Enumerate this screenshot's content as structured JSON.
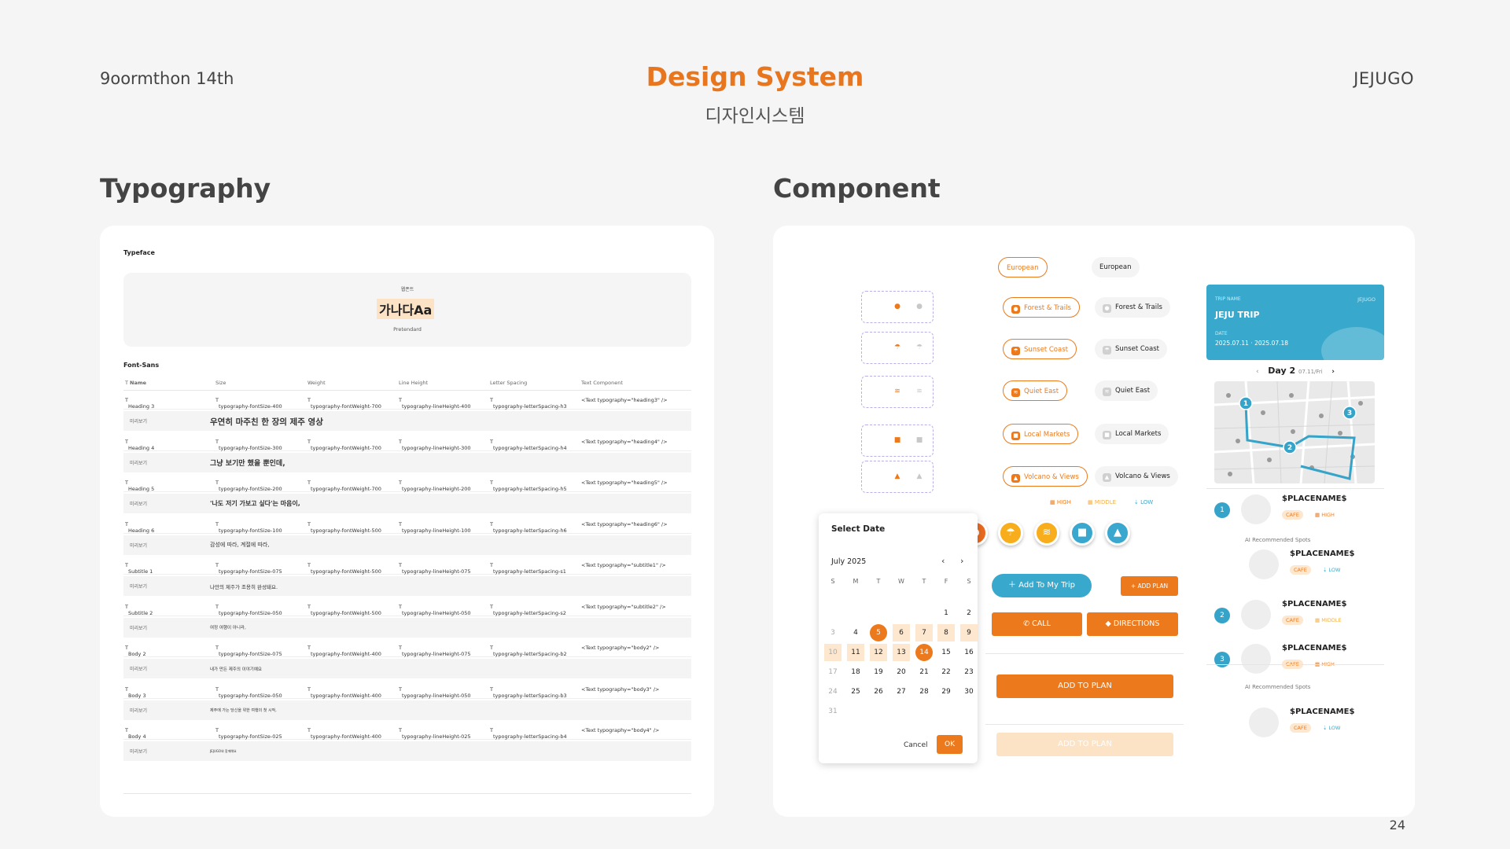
{
  "header": {
    "left": "9oormthon 14th",
    "title": "Design System",
    "subtitle": "디자인시스템",
    "right": "JEJUGO"
  },
  "sections": {
    "typography": "Typography",
    "component": "Component"
  },
  "page_number": "24",
  "typography": {
    "typeface_label": "Typeface",
    "typeface_kr": "웹폰트",
    "typeface_sample": "가나다Aa",
    "typeface_name": "Pretendard",
    "font_sans_label": "Font-Sans",
    "columns": [
      "Name",
      "Size",
      "Weight",
      "Line Height",
      "Letter Spacing",
      "Text Component"
    ],
    "preview_label": "미리보기",
    "rows": [
      {
        "name": "Heading 3",
        "size": "typography-fontSize-400",
        "weight": "typography-fontWeight-700",
        "line": "typography-lineHeight-400",
        "spacing": "typography-letterSpacing-h3",
        "component": "<Text typography=\"heading3\" />",
        "preview": "우연히 마주친 한 장의 제주 영상"
      },
      {
        "name": "Heading 4",
        "size": "typography-fontSize-300",
        "weight": "typography-fontWeight-700",
        "line": "typography-lineHeight-300",
        "spacing": "typography-letterSpacing-h4",
        "component": "<Text typography=\"heading4\" />",
        "preview": "그냥 보기만 했을 뿐인데,"
      },
      {
        "name": "Heading 5",
        "size": "typography-fontSize-200",
        "weight": "typography-fontWeight-700",
        "line": "typography-lineHeight-200",
        "spacing": "typography-letterSpacing-h5",
        "component": "<Text typography=\"heading5\" />",
        "preview": "'나도 저기 가보고 싶다'는 마음이,"
      },
      {
        "name": "Heading 6",
        "size": "typography-fontSize-100",
        "weight": "typography-fontWeight-500",
        "line": "typography-lineHeight-100",
        "spacing": "typography-letterSpacing-h6",
        "component": "<Text typography=\"heading6\" />",
        "preview": "감성에 따라, 계절에 따라,"
      },
      {
        "name": "Subtitle 1",
        "size": "typography-fontSize-075",
        "weight": "typography-fontWeight-500",
        "line": "typography-lineHeight-075",
        "spacing": "typography-letterSpacing-s1",
        "component": "<Text typography=\"subtitle1\" />",
        "preview": "나만의 제주가 조용히 완성돼요."
      },
      {
        "name": "Subtitle 2",
        "size": "typography-fontSize-050",
        "weight": "typography-fontWeight-500",
        "line": "typography-lineHeight-050",
        "spacing": "typography-letterSpacing-s2",
        "component": "<Text typography=\"subtitle2\" />",
        "preview": "여정 여행이 아니라,"
      },
      {
        "name": "Body 2",
        "size": "typography-fontSize-075",
        "weight": "typography-fontWeight-400",
        "line": "typography-lineHeight-075",
        "spacing": "typography-letterSpacing-b2",
        "component": "<Text typography=\"body2\" />",
        "preview": "내가 만든 제주의 이야기예요"
      },
      {
        "name": "Body 3",
        "size": "typography-fontSize-050",
        "weight": "typography-fontWeight-400",
        "line": "typography-lineHeight-050",
        "spacing": "typography-letterSpacing-b3",
        "component": "<Text typography=\"body3\" />",
        "preview": "제주에 가는 당신을 위한 여행의 첫 시작,"
      },
      {
        "name": "Body 4",
        "size": "typography-fontSize-025",
        "weight": "typography-fontWeight-400",
        "line": "typography-lineHeight-025",
        "spacing": "typography-letterSpacing-b4",
        "component": "<Text typography=\"body4\" />",
        "preview": "JEJUGO와 함께해요"
      }
    ]
  },
  "component": {
    "icon_glyphs": [
      "●",
      "☂",
      "≋",
      "■",
      "▲"
    ],
    "chips": [
      {
        "label": "European",
        "icon": false
      },
      {
        "label": "Forest & Trails",
        "icon": true
      },
      {
        "label": "Sunset Coast",
        "icon": true
      },
      {
        "label": "Quiet East",
        "icon": true
      },
      {
        "label": "Local Markets",
        "icon": true
      },
      {
        "label": "Volcano & Views",
        "icon": true
      }
    ],
    "priority": {
      "high": "HIGH",
      "middle": "MIDDLE",
      "low": "LOW"
    },
    "pin_colors": [
      "#ea6a1f",
      "#f7ad1c",
      "#f7ad1c",
      "#3aa7cf",
      "#3aa7cf"
    ],
    "buttons": {
      "add_to_my_trip": "Add To My Trip",
      "add_plan_small": "+ ADD PLAN",
      "call": "CALL",
      "directions": "DIRECTIONS",
      "add_to_plan": "ADD TO PLAN",
      "add_to_plan_disabled": "ADD TO PLAN"
    },
    "calendar": {
      "title": "Select Date",
      "month": "July 2025",
      "weekdays": [
        "S",
        "M",
        "T",
        "W",
        "T",
        "F",
        "S"
      ],
      "prev": "‹",
      "next": "›",
      "cancel": "Cancel",
      "ok": "OK"
    },
    "trip": {
      "name_label": "TRIP NAME",
      "logo": "JEJUGO",
      "name": "JEJU TRIP",
      "date_label": "DATE",
      "dates": "2025.07.11  ·  2025.07.18",
      "day": "Day 2",
      "day_date": "07.11/Fri"
    },
    "spots": [
      {
        "num": "1",
        "name": "$PLACENAME$",
        "tag": "CAFE",
        "level": "HIGH"
      },
      {
        "num": "",
        "name": "$PLACENAME$",
        "tag": "CAFE",
        "level": "LOW"
      },
      {
        "num": "2",
        "name": "$PLACENAME$",
        "tag": "CAFE",
        "level": "MIDDLE"
      },
      {
        "num": "3",
        "name": "$PLACENAME$",
        "tag": "CAFE",
        "level": "HIGH"
      },
      {
        "num": "",
        "name": "$PLACENAME$",
        "tag": "CAFE",
        "level": "LOW"
      }
    ],
    "ai_recommended": "AI Recommended Spots",
    "map_markers": [
      "1",
      "2",
      "3"
    ],
    "accent_color": "#ec7a1c",
    "teal_color": "#38a9cc"
  }
}
